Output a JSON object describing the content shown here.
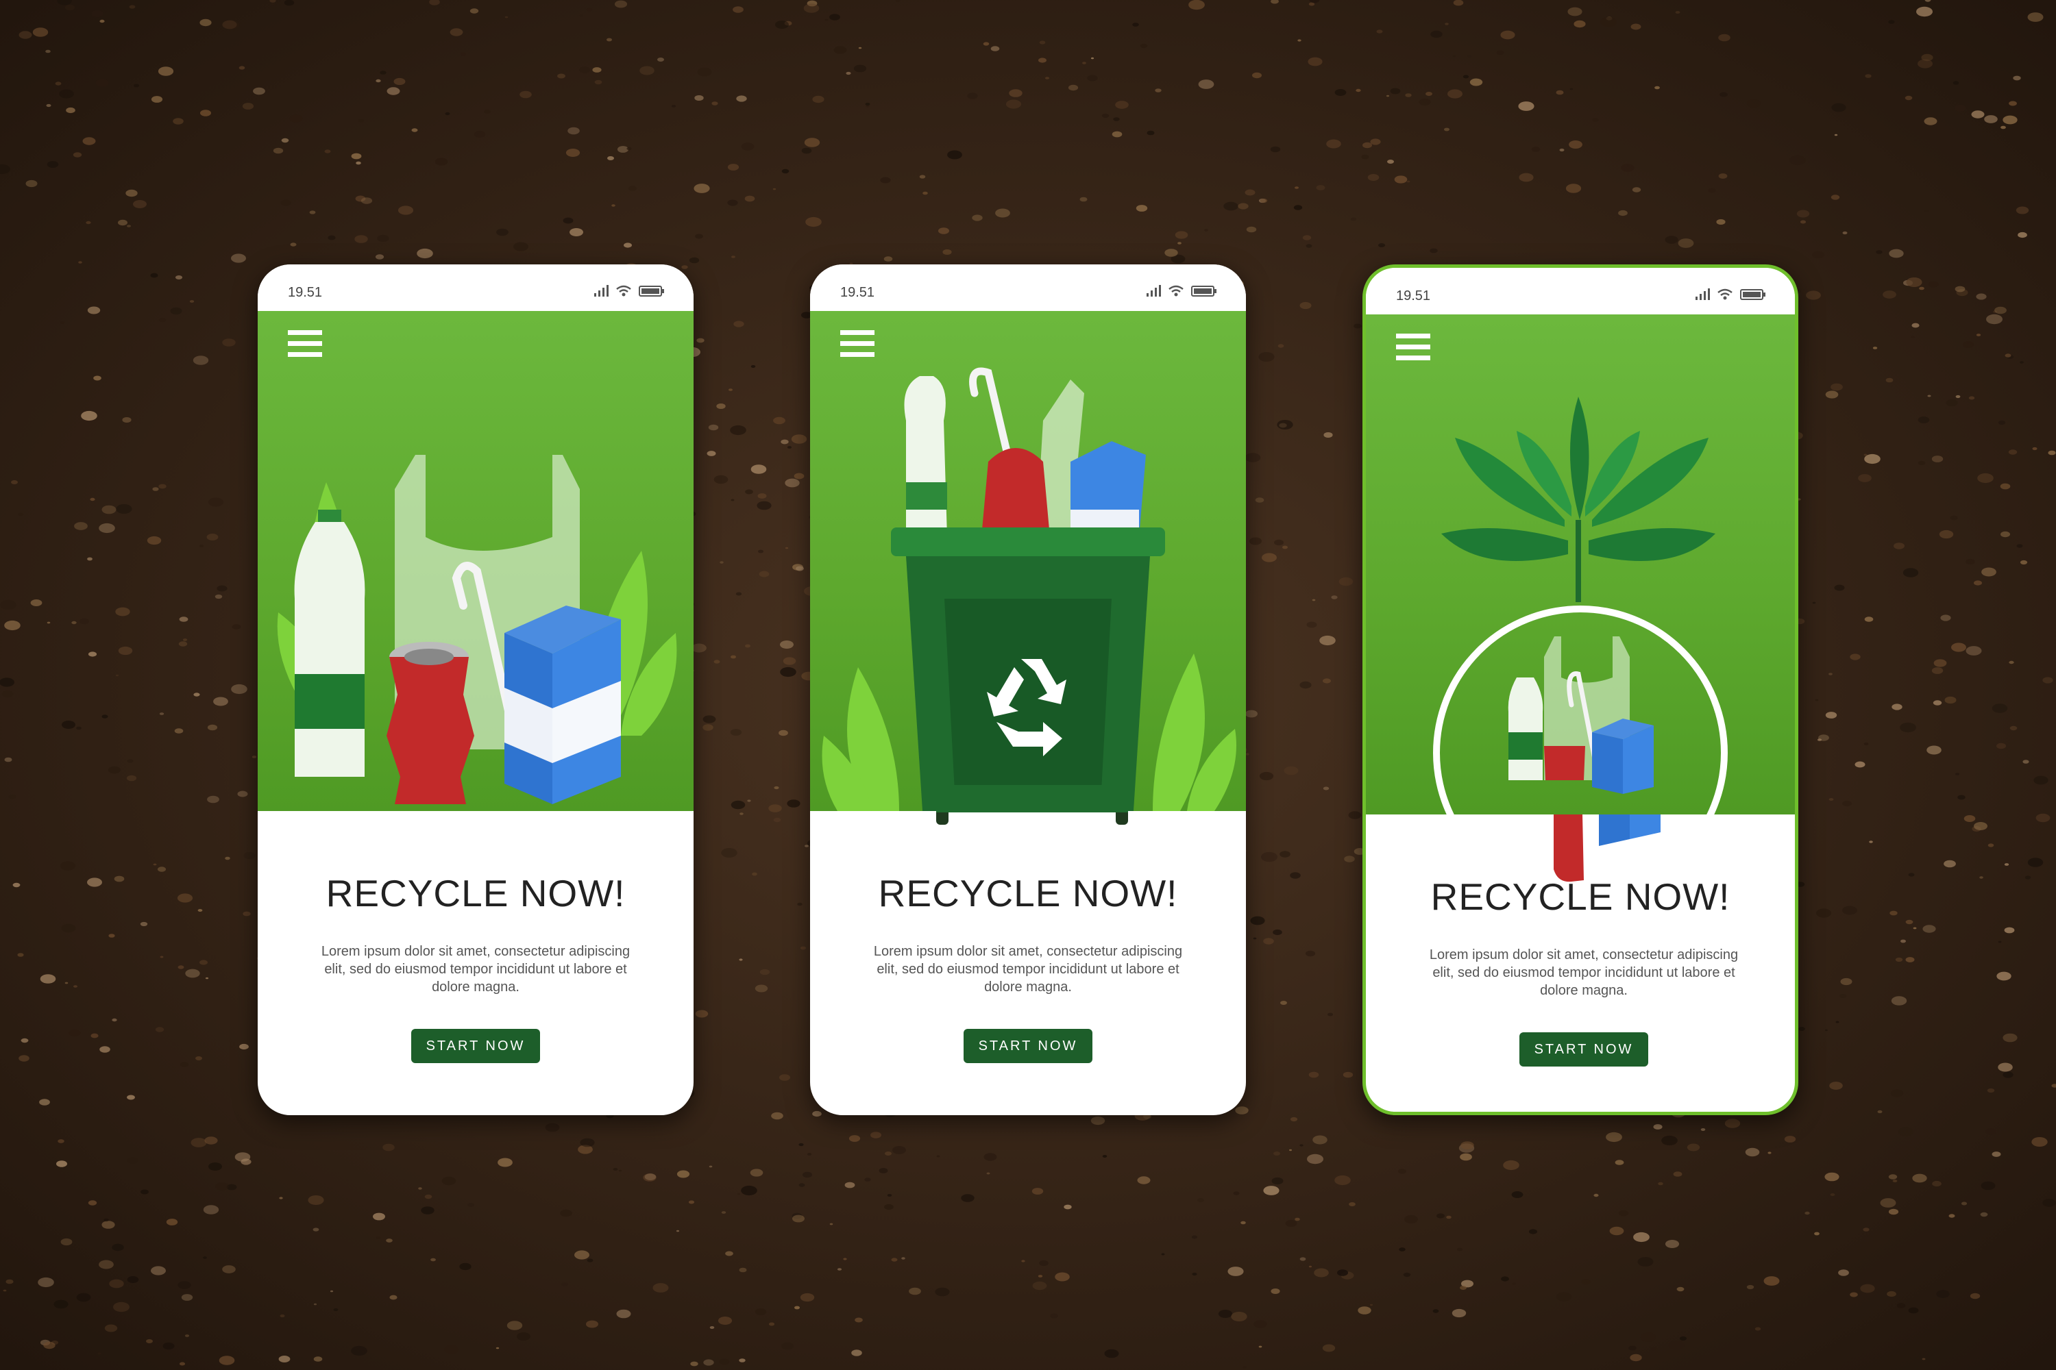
{
  "screens": [
    {
      "status": {
        "time": "19.51"
      },
      "title": "RECYCLE NOW!",
      "description": "Lorem ipsum dolor sit amet, consectetur adipiscing elit, sed do eiusmod tempor incididunt ut labore et dolore magna.",
      "cta_label": "START NOW"
    },
    {
      "status": {
        "time": "19.51"
      },
      "title": "RECYCLE NOW!",
      "description": "Lorem ipsum dolor sit amet, consectetur adipiscing elit, sed do eiusmod tempor incididunt ut labore et dolore magna.",
      "cta_label": "START NOW"
    },
    {
      "status": {
        "time": "19.51"
      },
      "title": "RECYCLE NOW!",
      "description": "Lorem ipsum dolor sit amet, consectetur adipiscing elit, sed do eiusmod tempor incididunt ut labore et dolore magna.",
      "cta_label": "START NOW"
    }
  ],
  "icons": {
    "menu": "hamburger-menu-icon",
    "signal": "signal-icon",
    "wifi": "wifi-icon",
    "battery": "battery-icon",
    "recycle": "recycle-icon"
  },
  "colors": {
    "soil": "#3a2718",
    "hero_green": "#5ea92e",
    "button_green": "#1d5e2a",
    "bin_green": "#1f6b2e",
    "can_red": "#c22a2a",
    "carton_blue": "#2f74d0"
  }
}
